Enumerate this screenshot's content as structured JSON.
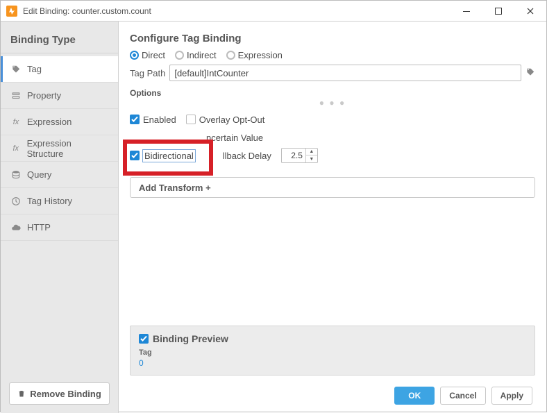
{
  "window": {
    "title": "Edit Binding: counter.custom.count"
  },
  "sidebar": {
    "heading": "Binding Type",
    "items": [
      {
        "label": "Tag"
      },
      {
        "label": "Property"
      },
      {
        "label": "Expression"
      },
      {
        "label": "Expression Structure"
      },
      {
        "label": "Query"
      },
      {
        "label": "Tag History"
      },
      {
        "label": "HTTP"
      }
    ],
    "remove": "Remove Binding"
  },
  "main": {
    "heading": "Configure Tag Binding",
    "modes": {
      "direct": "Direct",
      "indirect": "Indirect",
      "expression": "Expression"
    },
    "tag_path_label": "Tag Path",
    "tag_path_value": "[default]IntCounter",
    "options_label": "Options",
    "opts": {
      "enabled": "Enabled",
      "overlay": "Overlay Opt-Out",
      "uncertain_tail": "ncertain Value",
      "bidirectional": "Bidirectional",
      "fallback_fragment": "llback Delay",
      "fallback_value": "2.5"
    },
    "add_transform": "Add Transform +"
  },
  "preview": {
    "title": "Binding Preview",
    "sub": "Tag",
    "value": "0"
  },
  "footer": {
    "ok": "OK",
    "cancel": "Cancel",
    "apply": "Apply"
  }
}
